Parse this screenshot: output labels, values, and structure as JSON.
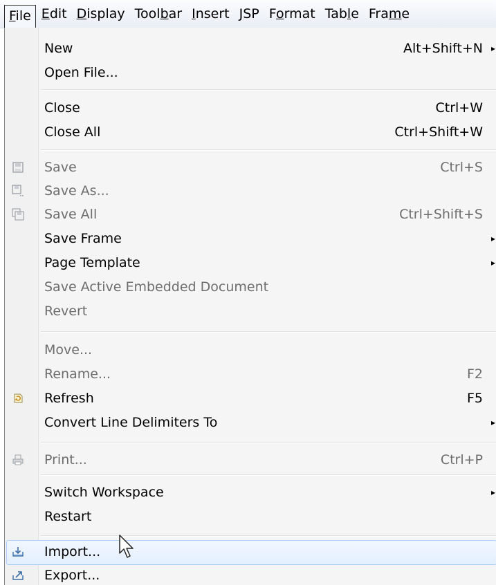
{
  "menubar": {
    "items": [
      {
        "label": "File",
        "underline": "F",
        "rest": "ile"
      },
      {
        "label": "Edit",
        "underline": "E",
        "rest": "dit"
      },
      {
        "label": "Display",
        "underline": "D",
        "rest": "isplay"
      },
      {
        "pre": "Tool",
        "underline": "b",
        "rest": "ar"
      },
      {
        "label": "Insert",
        "underline": "I",
        "rest": "nsert"
      },
      {
        "label": "JSP",
        "underline": "J",
        "rest": "SP"
      },
      {
        "pre": "F",
        "underline": "o",
        "rest": "rmat"
      },
      {
        "pre": "Tab",
        "underline": "l",
        "rest": "e"
      },
      {
        "pre": "Fra",
        "underline": "m",
        "rest": "e"
      }
    ]
  },
  "menu": {
    "new": {
      "label": "New",
      "shortcut": "Alt+Shift+N"
    },
    "open_file": {
      "label": "Open File..."
    },
    "close": {
      "label": "Close",
      "shortcut": "Ctrl+W"
    },
    "close_all": {
      "label": "Close All",
      "shortcut": "Ctrl+Shift+W"
    },
    "save": {
      "label": "Save",
      "shortcut": "Ctrl+S"
    },
    "save_as": {
      "label": "Save As..."
    },
    "save_all": {
      "label": "Save All",
      "shortcut": "Ctrl+Shift+S"
    },
    "save_frame": {
      "label": "Save Frame"
    },
    "page_template": {
      "label": "Page Template"
    },
    "save_active_embedded": {
      "label": "Save Active Embedded Document"
    },
    "revert": {
      "label": "Revert"
    },
    "move": {
      "label": "Move..."
    },
    "rename": {
      "label": "Rename...",
      "shortcut": "F2"
    },
    "refresh": {
      "label": "Refresh",
      "shortcut": "F5"
    },
    "convert_line_delimiters": {
      "label": "Convert Line Delimiters To"
    },
    "print": {
      "label": "Print...",
      "shortcut": "Ctrl+P"
    },
    "switch_workspace": {
      "label": "Switch Workspace"
    },
    "restart": {
      "label": "Restart"
    },
    "import": {
      "label": "Import..."
    },
    "export": {
      "label": "Export..."
    }
  },
  "icons": {
    "submenu_arrow": "▸"
  }
}
